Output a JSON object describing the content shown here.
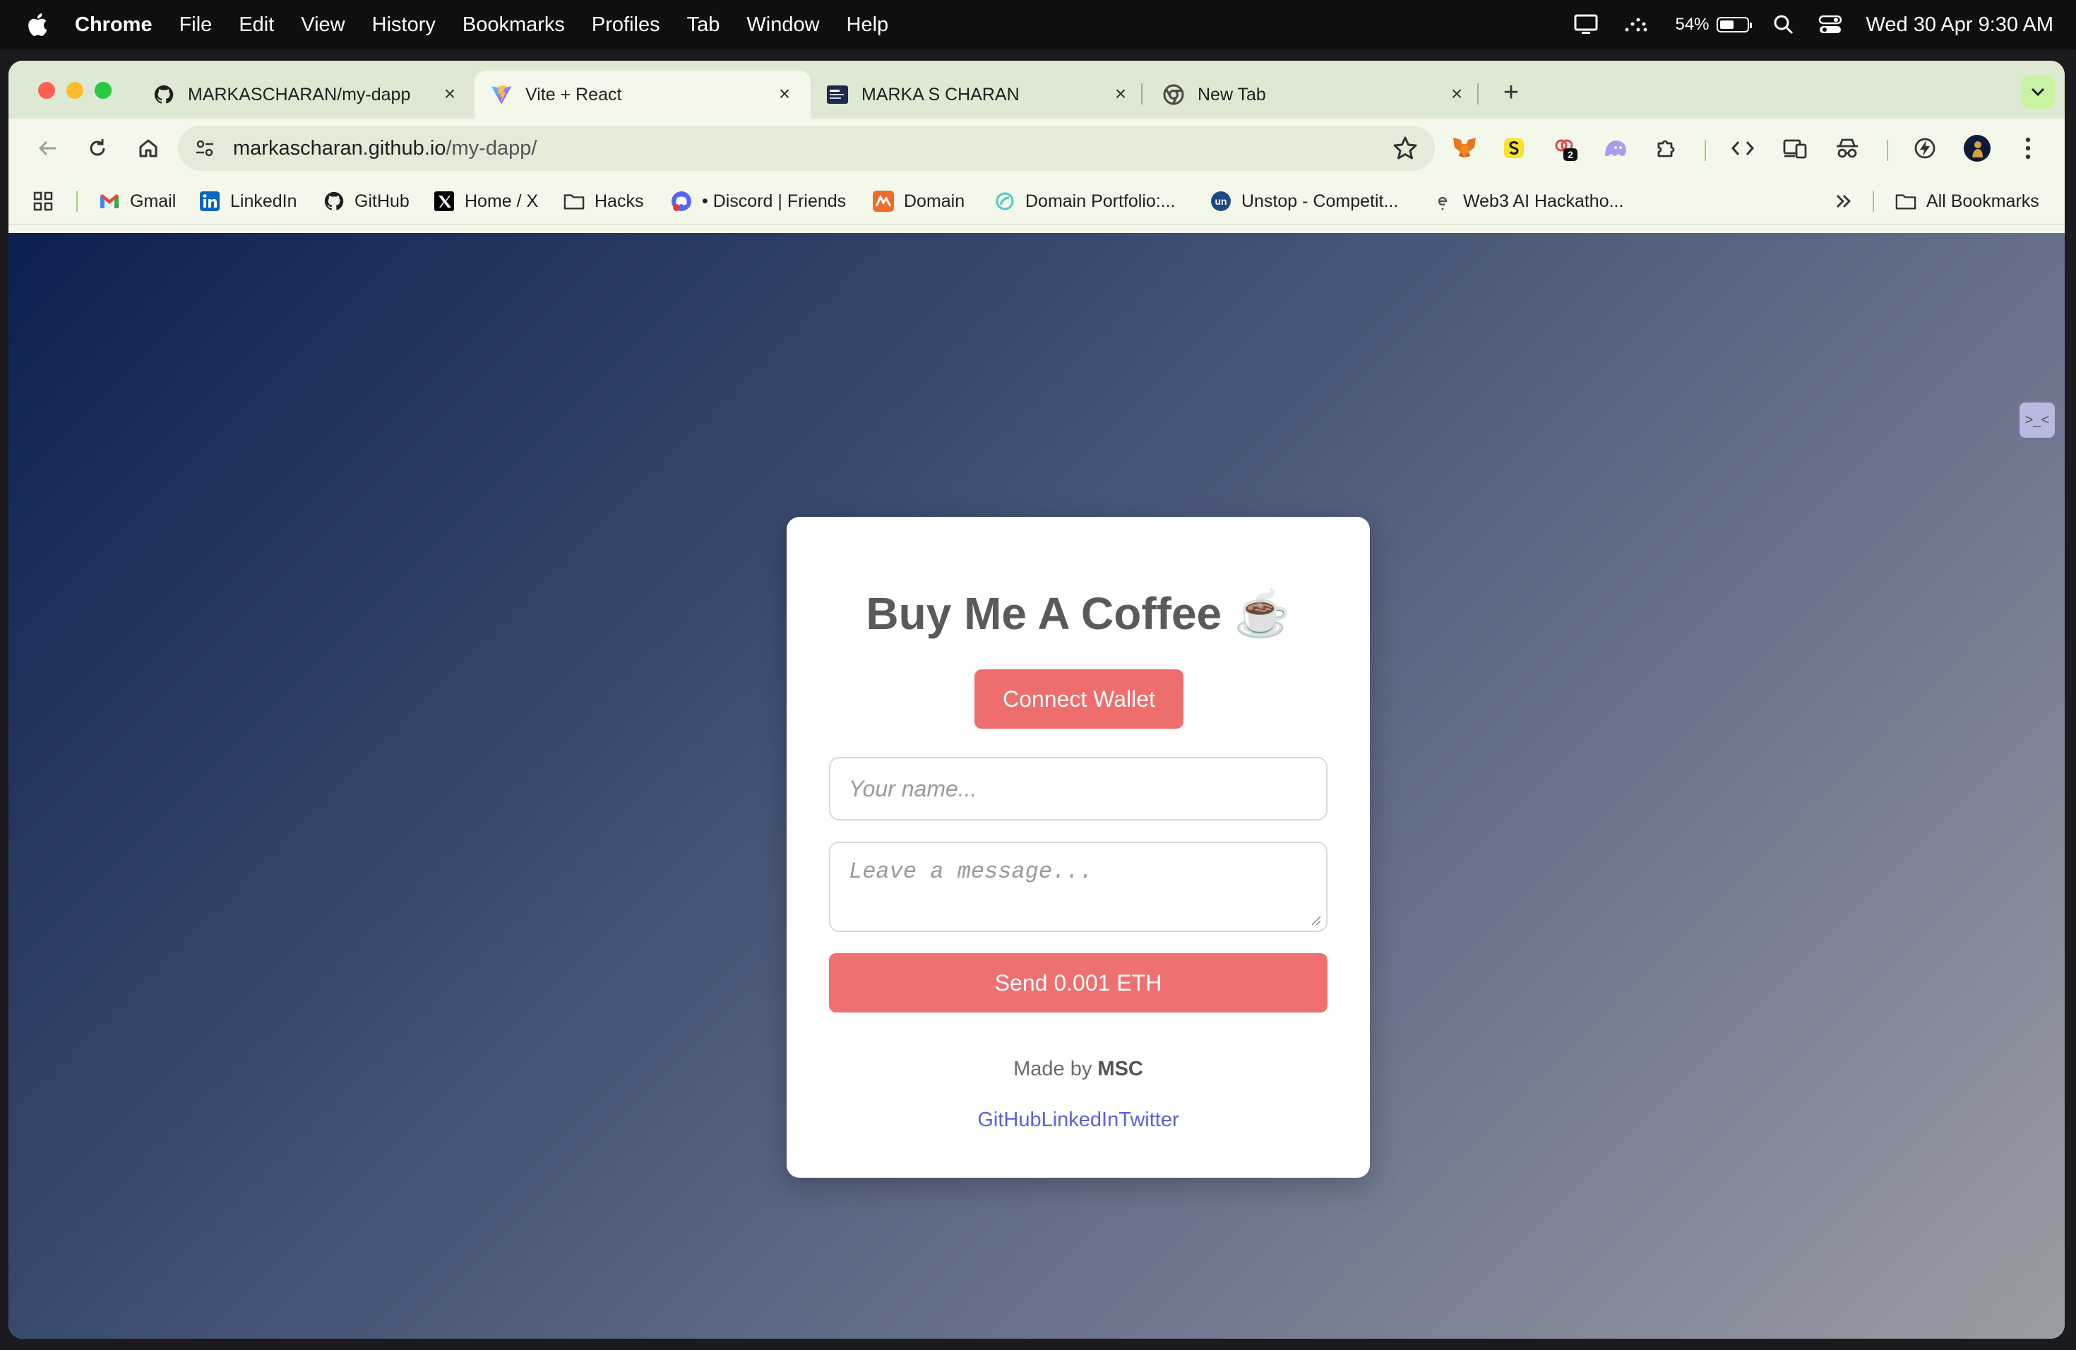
{
  "menubar": {
    "app": "Chrome",
    "items": [
      "File",
      "Edit",
      "View",
      "History",
      "Bookmarks",
      "Profiles",
      "Tab",
      "Window",
      "Help"
    ],
    "battery": "54%",
    "battery_level": 0.54,
    "clock": "Wed 30 Apr  9:30 AM"
  },
  "tabs": [
    {
      "title": "MARKASCHARAN/my-dapp",
      "icon": "github-icon"
    },
    {
      "title": "Vite + React",
      "icon": "vite-icon",
      "active": true
    },
    {
      "title": "MARKA S CHARAN",
      "icon": "portfolio-icon"
    },
    {
      "title": "New Tab",
      "icon": "chrome-icon"
    }
  ],
  "address": {
    "host": "markascharan.github.io",
    "path": "/my-dapp/"
  },
  "extensions": {
    "badge": "2"
  },
  "bookmarks": [
    {
      "label": "Gmail",
      "icon": "gmail-icon"
    },
    {
      "label": "LinkedIn",
      "icon": "linkedin-icon"
    },
    {
      "label": "GitHub",
      "icon": "github-icon"
    },
    {
      "label": "Home / X",
      "icon": "x-icon"
    },
    {
      "label": "Hacks",
      "icon": "folder-icon"
    },
    {
      "label": "• Discord | Friends",
      "icon": "discord-icon"
    },
    {
      "label": "Domain",
      "icon": "domain-icon"
    },
    {
      "label": "Domain Portfolio:...",
      "icon": "portfolio-icon"
    },
    {
      "label": "Unstop - Competit...",
      "icon": "unstop-icon"
    },
    {
      "label": "Web3 AI Hackatho...",
      "icon": "web3-icon"
    }
  ],
  "all_bookmarks": "All Bookmarks",
  "side_widget": ">_<",
  "app": {
    "title": "Buy Me A Coffee ☕",
    "connect_label": "Connect Wallet",
    "name_placeholder": "Your name...",
    "message_placeholder": "Leave a message...",
    "send_label": "Send 0.001 ETH",
    "made_by_prefix": "Made by",
    "made_by_name": "MSC",
    "links": [
      "GitHub",
      "LinkedIn",
      "Twitter"
    ]
  },
  "colors": {
    "accent": "#ee6d6d",
    "link": "#5b5fe0"
  }
}
